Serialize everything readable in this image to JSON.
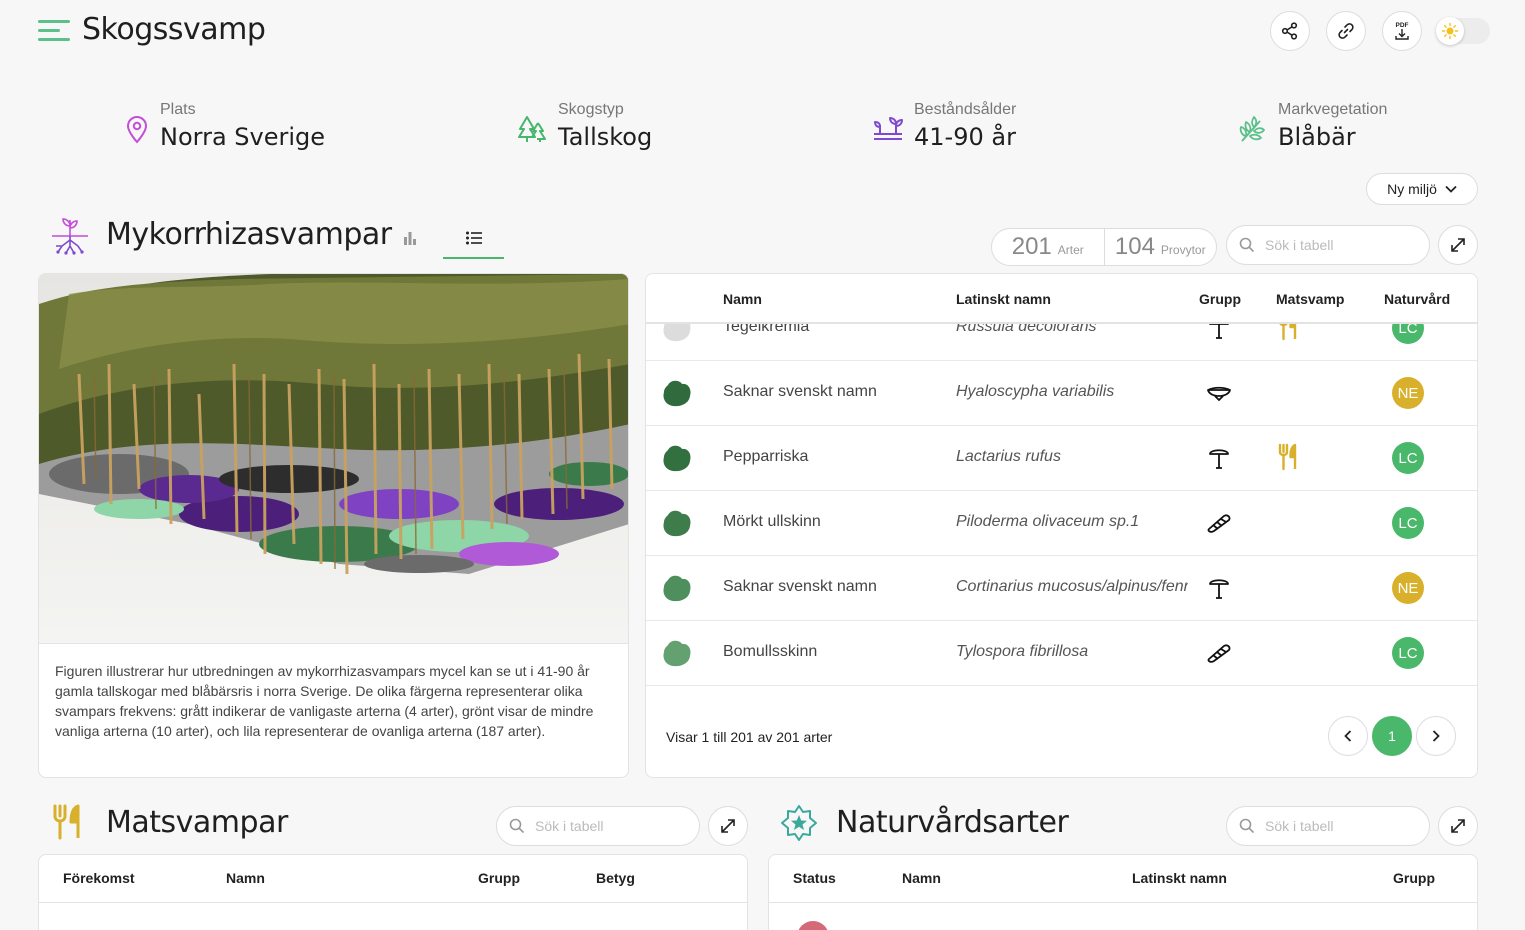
{
  "header": {
    "title": "Skogssvamp"
  },
  "info": [
    {
      "label": "Plats",
      "value": "Norra Sverige",
      "icon": "location-pin-icon",
      "color": "#c44ed8"
    },
    {
      "label": "Skogstyp",
      "value": "Tallskog",
      "icon": "trees-icon",
      "color": "#48b66f"
    },
    {
      "label": "Beståndsålder",
      "value": "41-90 år",
      "icon": "sprouts-icon",
      "color": "#7d4ad1"
    },
    {
      "label": "Markvegetation",
      "value": "Blåbär",
      "icon": "leaves-icon",
      "color": "#5cc08a"
    }
  ],
  "ny_miljo": "Ny miljö",
  "myko": {
    "title": "Mykorrhizasvampar",
    "counts": {
      "arter_num": "201",
      "arter_label": "Arter",
      "provytor_num": "104",
      "provytor_label": "Provytor"
    },
    "search_placeholder": "Sök i tabell",
    "caption": "Figuren illustrerar hur utbredningen av mykorrhizasvampars mycel kan se ut i 41-90 år gamla tallskogar med blåbärsris i norra Sverige. De olika färgerna representerar olika svampars frekvens: grått indikerar de vanligaste arterna (4 arter), grönt visar de mindre vanliga arterna (10 arter), och lila representerar de ovanliga arterna (187 arter).",
    "columns": {
      "namn": "Namn",
      "latin": "Latinskt namn",
      "grupp": "Grupp",
      "matsvamp": "Matsvamp",
      "naturvard": "Naturvård"
    },
    "rows": [
      {
        "name": "Tegelkremla",
        "latin": "Russula decolorans",
        "blob": "#dcdcdc",
        "group": "cap",
        "edible": true,
        "status": "LC",
        "status_color": "#4ab86a"
      },
      {
        "name": "Saknar svenskt namn",
        "latin": "Hyaloscypha variabilis",
        "blob": "#2f6b3c",
        "group": "cup",
        "edible": false,
        "status": "NE",
        "status_color": "#d9b02b"
      },
      {
        "name": "Pepparriska",
        "latin": "Lactarius rufus",
        "blob": "#33703f",
        "group": "cap",
        "edible": true,
        "status": "LC",
        "status_color": "#4ab86a"
      },
      {
        "name": "Mörkt ullskinn",
        "latin": "Piloderma olivaceum sp.1",
        "blob": "#3e7c4b",
        "group": "crust",
        "edible": false,
        "status": "LC",
        "status_color": "#4ab86a"
      },
      {
        "name": "Saknar svenskt namn",
        "latin": "Cortinarius mucosus/alpinus/fennoscandicus",
        "blob": "#4f8e5d",
        "group": "cap",
        "edible": false,
        "status": "NE",
        "status_color": "#d9b02b"
      },
      {
        "name": "Bomullsskinn",
        "latin": "Tylospora fibrillosa",
        "blob": "#64a170",
        "group": "crust",
        "edible": false,
        "status": "LC",
        "status_color": "#4ab86a"
      }
    ],
    "footer": "Visar 1 till 201 av 201 arter",
    "page": "1"
  },
  "mat": {
    "title": "Matsvampar",
    "search_placeholder": "Sök i tabell",
    "columns": {
      "forekomst": "Förekomst",
      "namn": "Namn",
      "grupp": "Grupp",
      "betyg": "Betyg"
    }
  },
  "natur": {
    "title": "Naturvårdsarter",
    "search_placeholder": "Sök i tabell",
    "columns": {
      "status": "Status",
      "namn": "Namn",
      "latin": "Latinskt namn",
      "grupp": "Grupp"
    }
  },
  "colors": {
    "accent": "#4ab86a",
    "gold": "#d9b02b",
    "purple": "#7d4ad1"
  }
}
